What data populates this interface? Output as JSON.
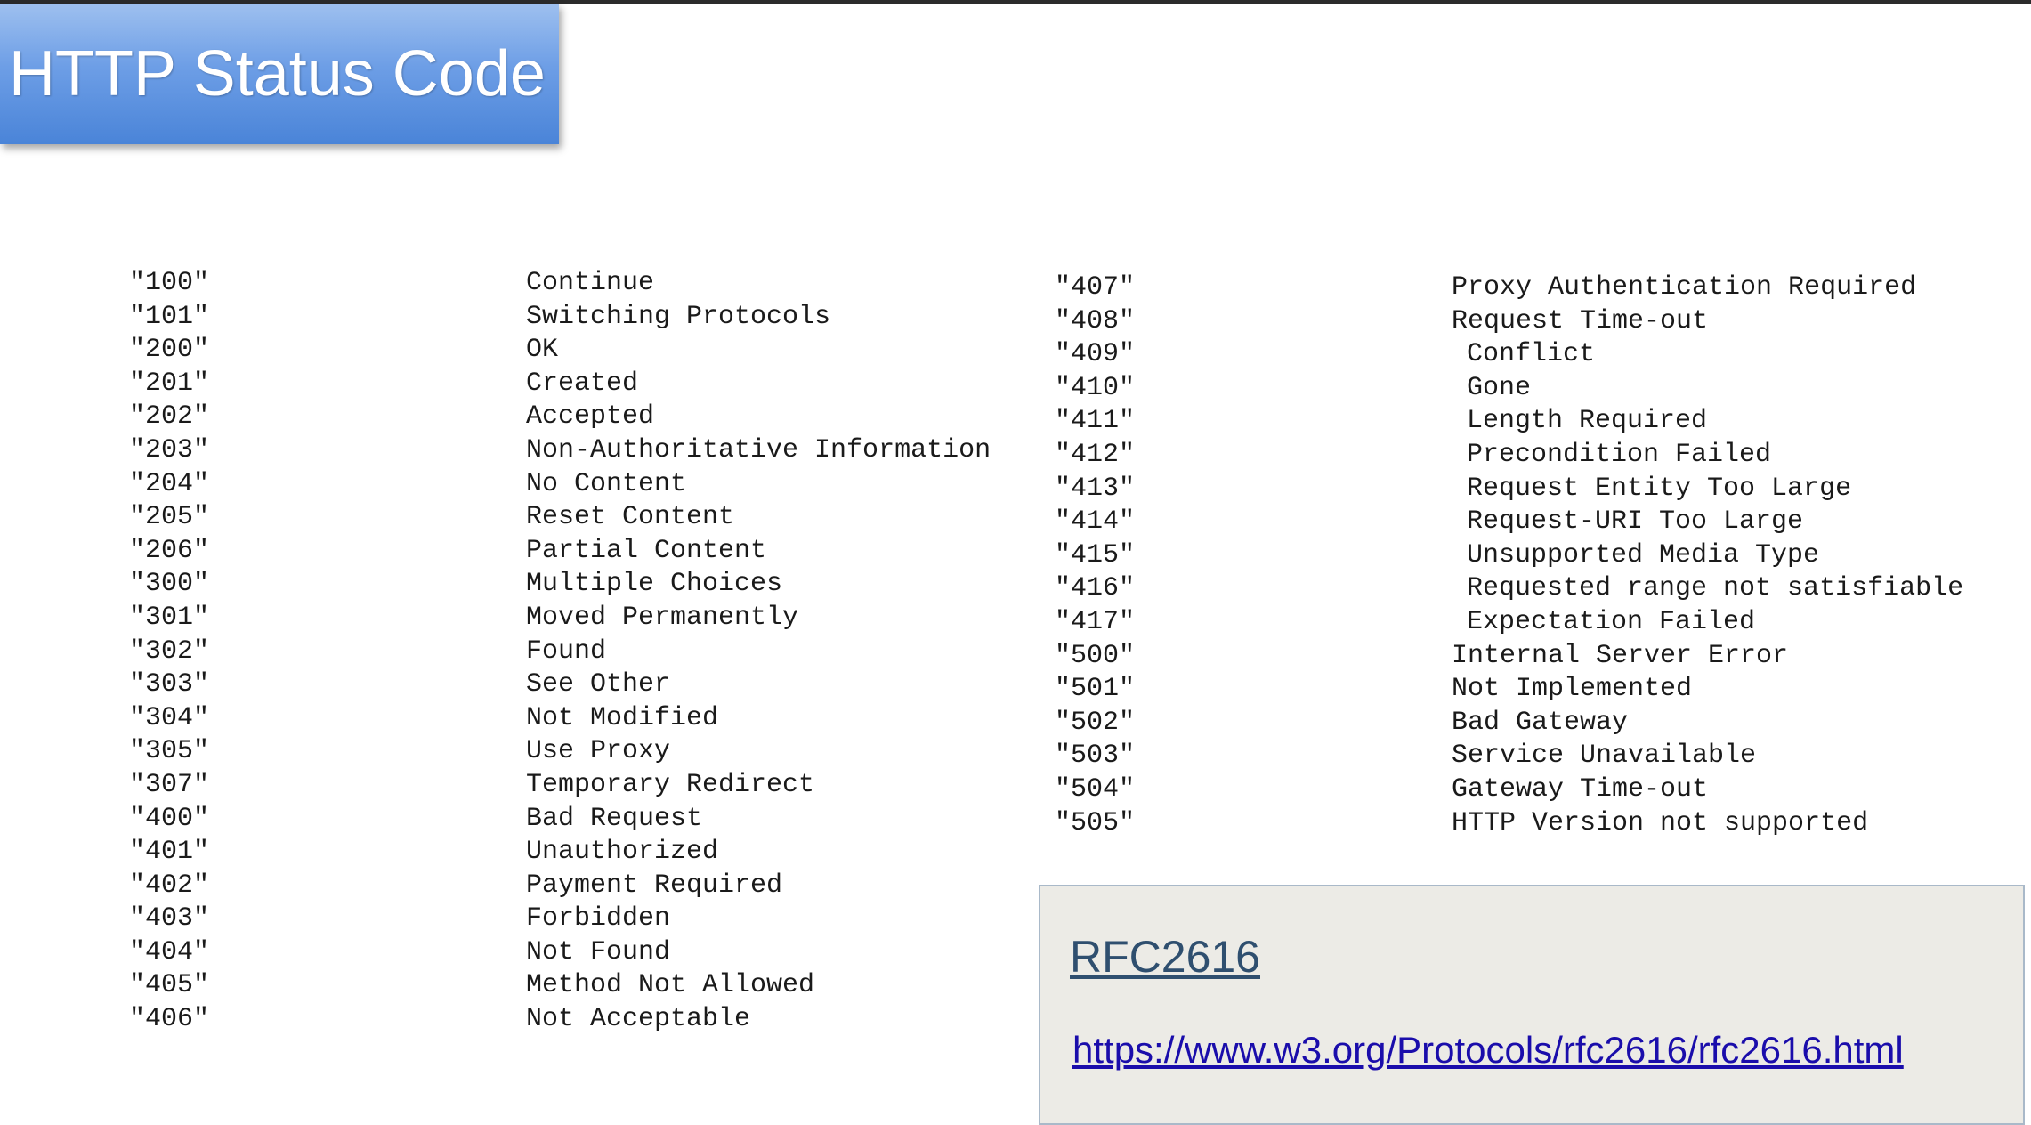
{
  "title": "HTTP Status Code",
  "left_column": [
    {
      "code": "\"100\"",
      "text": "Continue"
    },
    {
      "code": "\"101\"",
      "text": "Switching Protocols"
    },
    {
      "code": "\"200\"",
      "text": "OK"
    },
    {
      "code": "\"201\"",
      "text": "Created"
    },
    {
      "code": "\"202\"",
      "text": "Accepted"
    },
    {
      "code": "\"203\"",
      "text": "Non-Authoritative Information"
    },
    {
      "code": "\"204\"",
      "text": "No Content"
    },
    {
      "code": "\"205\"",
      "text": "Reset Content"
    },
    {
      "code": "\"206\"",
      "text": "Partial Content"
    },
    {
      "code": "\"300\"",
      "text": "Multiple Choices"
    },
    {
      "code": "\"301\"",
      "text": "Moved Permanently"
    },
    {
      "code": "\"302\"",
      "text": "Found"
    },
    {
      "code": "\"303\"",
      "text": "See Other"
    },
    {
      "code": "\"304\"",
      "text": "Not Modified"
    },
    {
      "code": "\"305\"",
      "text": "Use Proxy"
    },
    {
      "code": "\"307\"",
      "text": "Temporary Redirect"
    },
    {
      "code": "\"400\"",
      "text": "Bad Request"
    },
    {
      "code": "\"401\"",
      "text": "Unauthorized"
    },
    {
      "code": "\"402\"",
      "text": "Payment Required"
    },
    {
      "code": "\"403\"",
      "text": "Forbidden"
    },
    {
      "code": "\"404\"",
      "text": "Not Found"
    },
    {
      "code": "\"405\"",
      "text": "Method Not Allowed"
    },
    {
      "code": "\"406\"",
      "text": "Not Acceptable"
    }
  ],
  "right_column": [
    {
      "code": "\"407\"",
      "text": "Proxy Authentication Required"
    },
    {
      "code": "\"408\"",
      "text": "Request Time-out"
    },
    {
      "code": "\"409\"",
      "text": "Conflict"
    },
    {
      "code": "\"410\"",
      "text": "Gone"
    },
    {
      "code": "\"411\"",
      "text": "Length Required"
    },
    {
      "code": "\"412\"",
      "text": "Precondition Failed"
    },
    {
      "code": "\"413\"",
      "text": "Request Entity Too Large"
    },
    {
      "code": "\"414\"",
      "text": "Request-URI Too Large"
    },
    {
      "code": "\"415\"",
      "text": "Unsupported Media Type"
    },
    {
      "code": "\"416\"",
      "text": "Requested range not satisfiable"
    },
    {
      "code": "\"417\"",
      "text": "Expectation Failed"
    },
    {
      "code": "\"500\"",
      "text": "Internal Server Error"
    },
    {
      "code": "\"501\"",
      "text": "Not Implemented"
    },
    {
      "code": "\"502\"",
      "text": "Bad Gateway"
    },
    {
      "code": "\"503\"",
      "text": "Service Unavailable"
    },
    {
      "code": "\"504\"",
      "text": "Gateway Time-out"
    },
    {
      "code": "\"505\"",
      "text": "HTTP Version not supported"
    }
  ],
  "reference": {
    "title": "RFC2616",
    "url": "https://www.w3.org/Protocols/rfc2616/rfc2616.html"
  },
  "colors": {
    "banner": "#6d9ee6",
    "link": "#1a0dab",
    "reference_box": "#ecebe6"
  }
}
